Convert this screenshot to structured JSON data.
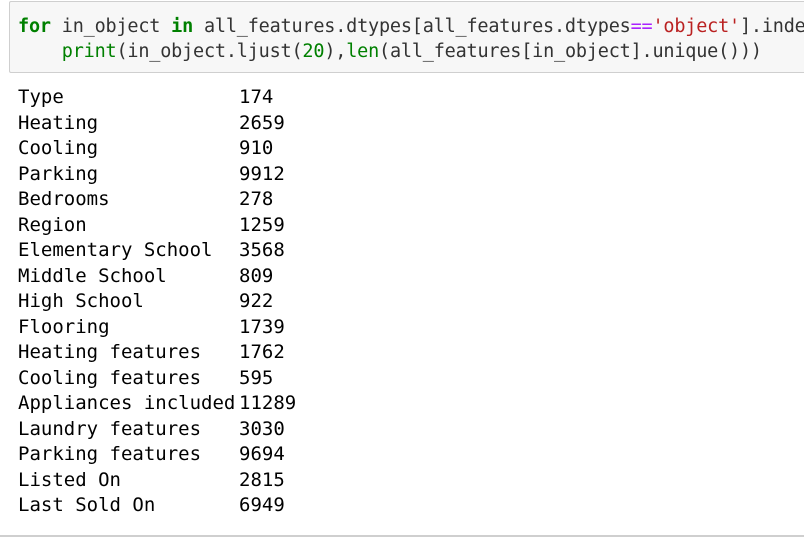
{
  "code": {
    "line1": {
      "kw_for": "for",
      "var": " in_object ",
      "kw_in": "in",
      "expr_a": " all_features.dtypes[all_features.dtypes",
      "op_eq": "==",
      "str_object": "'object'",
      "expr_b": "].index:"
    },
    "line2": {
      "indent": "    ",
      "fn_print": "print",
      "expr_a": "(in_object.ljust(",
      "num_20": "20",
      "expr_b": "),",
      "fn_len": "len",
      "expr_c": "(all_features[in_object].unique()))",
      "spacing": "    ",
      "comment": "#"
    }
  },
  "output": {
    "rows": [
      {
        "name": "Type",
        "count": "174"
      },
      {
        "name": "Heating",
        "count": "2659"
      },
      {
        "name": "Cooling",
        "count": "910"
      },
      {
        "name": "Parking",
        "count": "9912"
      },
      {
        "name": "Bedrooms",
        "count": "278"
      },
      {
        "name": "Region",
        "count": "1259"
      },
      {
        "name": "Elementary School",
        "count": "3568"
      },
      {
        "name": "Middle School",
        "count": "809"
      },
      {
        "name": "High School",
        "count": "922"
      },
      {
        "name": "Flooring",
        "count": "1739"
      },
      {
        "name": "Heating features",
        "count": "1762"
      },
      {
        "name": "Cooling features",
        "count": "595"
      },
      {
        "name": "Appliances included",
        "count": "11289"
      },
      {
        "name": "Laundry features",
        "count": "3030"
      },
      {
        "name": "Parking features",
        "count": "9694"
      },
      {
        "name": "Listed On",
        "count": "2815"
      },
      {
        "name": "Last Sold On",
        "count": "6949"
      }
    ]
  }
}
